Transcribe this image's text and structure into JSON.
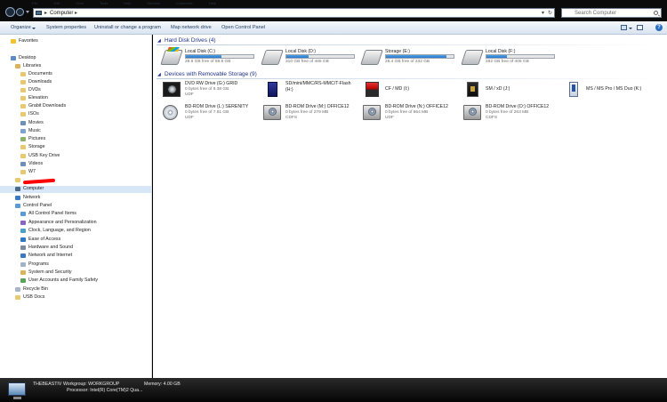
{
  "window": {
    "menu_ghost": [
      "File",
      "Edit",
      "View",
      "Tools",
      "Help",
      "Window",
      "Customize",
      "Help"
    ],
    "breadcrumb": "Computer",
    "search_placeholder": "Search Computer"
  },
  "toolbar": {
    "organize": "Organize",
    "system_properties": "System properties",
    "uninstall": "Uninstall or change a program",
    "map_drive": "Map network drive",
    "control_panel": "Open Control Panel"
  },
  "nav": {
    "favorites": "Favorites",
    "desktop": "Desktop",
    "libraries": "Libraries",
    "library_items": [
      "Documents",
      "Downloads",
      "DVDs",
      "Elevation",
      "Grabit Downloads",
      "ISOs",
      "Movies",
      "Music",
      "Pictures",
      "Storage",
      "USB Key Drive",
      "Videos",
      "W7"
    ],
    "computer": "Computer",
    "network": "Network",
    "control_panel": "Control Panel",
    "cp_items": [
      "All Control Panel Items",
      "Appearance and Personalization",
      "Clock, Language, and Region",
      "Ease of Access",
      "Hardware and Sound",
      "Network and Internet",
      "Programs",
      "System and Security",
      "User Accounts and Family Safety"
    ],
    "recycle_bin": "Recycle Bin",
    "usb_docs": "USB Docs"
  },
  "groups": {
    "hdd_title": "Hard Disk Drives (4)",
    "removable_title": "Devices with Removable Storage (9)"
  },
  "hard_drives": [
    {
      "name": "Local Disk (C:)",
      "free": "28.6 GB free of 59.9 GB",
      "used_fraction": 0.52
    },
    {
      "name": "Local Disk (D:)",
      "free": "310 GB free of 465 GB",
      "used_fraction": 0.33
    },
    {
      "name": "Storage (E:)",
      "free": "26.4 GB free of 232 GB",
      "used_fraction": 0.89
    },
    {
      "name": "Local Disk (F:)",
      "free": "282 GB free of 405 GB",
      "used_fraction": 0.3
    }
  ],
  "removable": [
    {
      "name": "DVD RW Drive (G:) GRID",
      "line2": "0 bytes free of 6.38 GB",
      "line3": "UDF",
      "icon": "dvd-drive-icon"
    },
    {
      "name": "SD/mini/MMC/RS-MMC/T-Flash",
      "line2": "(H:)",
      "line3": "",
      "icon": "sd-card-icon"
    },
    {
      "name": "CF / MD (I:)",
      "line2": "",
      "line3": "",
      "icon": "cf-card-icon"
    },
    {
      "name": "SM / xD (J:)",
      "line2": "",
      "line3": "",
      "icon": "sm-card-icon"
    },
    {
      "name": "MS / MS Pro / MS Duo (K:)",
      "line2": "",
      "line3": "",
      "icon": "memory-stick-icon"
    },
    {
      "name": "BD-ROM Drive (L:) SERENITY",
      "line2": "0 bytes free of 7.81 GB",
      "line3": "UDF",
      "icon": "bd-disc-icon"
    },
    {
      "name": "BD-ROM Drive (M:) OFFICE12",
      "line2": "0 bytes free of 279 MB",
      "line3": "CDFS",
      "icon": "bd-drive-icon"
    },
    {
      "name": "BD-ROM Drive (N:) OFFICE12",
      "line2": "0 bytes free of 664 MB",
      "line3": "UDF",
      "icon": "bd-drive-icon"
    },
    {
      "name": "BD-ROM Drive (O:) OFFICE12",
      "line2": "0 bytes free of 263 MB",
      "line3": "CDFS",
      "icon": "bd-drive-icon"
    }
  ],
  "details": {
    "computer_name": "THEBEASTIV",
    "workgroup": "Workgroup: WORKGROUP",
    "memory": "Memory: 4.00 GB",
    "processor": "Processor: Intel(R) Core(TM)2 Qua..."
  },
  "colors": {
    "group_header": "#1e3287",
    "bar_fill": "#2a77c8",
    "annotation_red": "#ff0000"
  }
}
